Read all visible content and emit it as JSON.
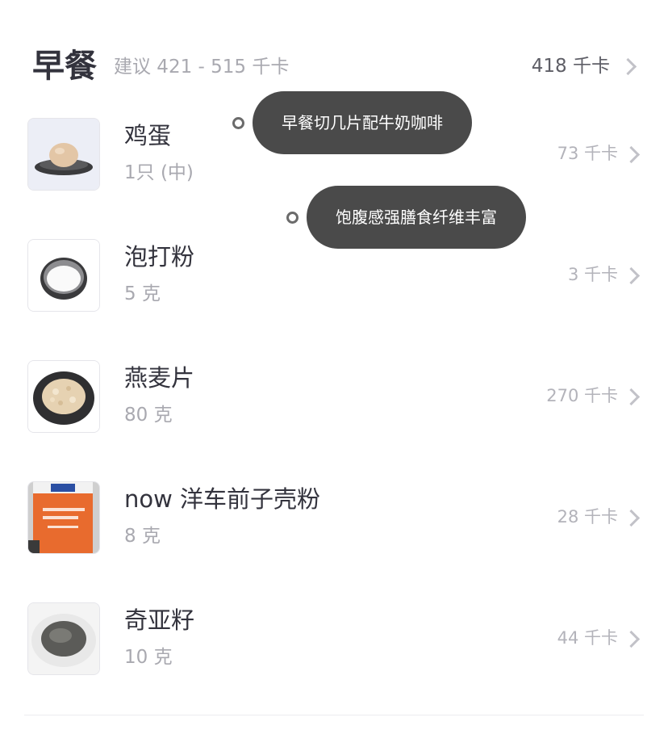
{
  "meal": {
    "title": "早餐",
    "suggestion": "建议 421 - 515 千卡",
    "total": "418 千卡"
  },
  "foods": [
    {
      "name": "鸡蛋",
      "quantity": "1只 (中)",
      "kcal": "73 千卡",
      "image_icon": "egg-image"
    },
    {
      "name": "泡打粉",
      "quantity": "5 克",
      "kcal": "3 千卡",
      "image_icon": "baking-powder-image"
    },
    {
      "name": "燕麦片",
      "quantity": "80 克",
      "kcal": "270 千卡",
      "image_icon": "oats-image"
    },
    {
      "name": "now 洋车前子壳粉",
      "quantity": "8 克",
      "kcal": "28 千卡",
      "image_icon": "psyllium-powder-image"
    },
    {
      "name": "奇亚籽",
      "quantity": "10 克",
      "kcal": "44 千卡",
      "image_icon": "chia-seeds-image"
    }
  ],
  "annotations": [
    {
      "text": "早餐切几片配牛奶咖啡"
    },
    {
      "text": "饱腹感强膳食纤维丰富"
    }
  ],
  "colors": {
    "bubble": "#4a4a4a",
    "text_primary": "#33333d",
    "text_secondary": "#a9a9b0"
  }
}
